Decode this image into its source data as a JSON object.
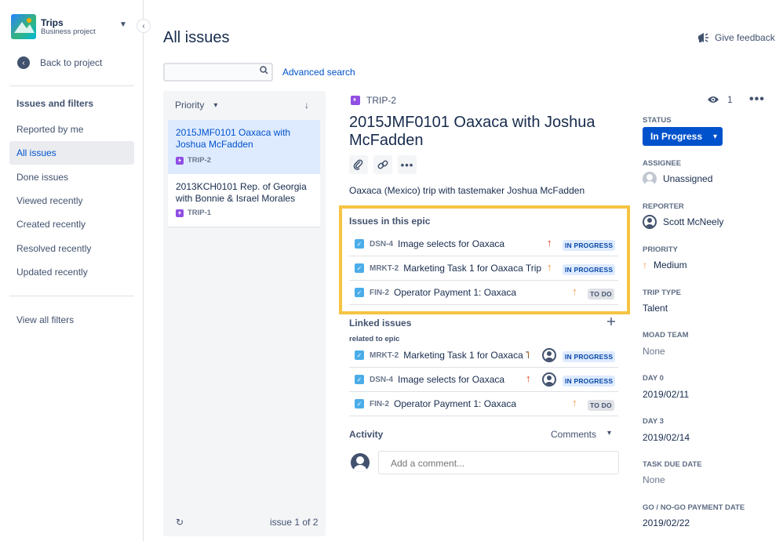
{
  "colors": {
    "accent": "#0052cc",
    "epic": "#904ee2",
    "task": "#4bade8",
    "highlight": "#f6c342",
    "priority_high": "#de350b",
    "priority_medium": "#f79233"
  },
  "sidebar": {
    "project_name": "Trips",
    "project_type": "Business project",
    "back_label": "Back to project",
    "heading": "Issues and filters",
    "items": [
      {
        "label": "Reported by me",
        "active": false
      },
      {
        "label": "All issues",
        "active": true
      },
      {
        "label": "Done issues",
        "active": false
      },
      {
        "label": "Viewed recently",
        "active": false
      },
      {
        "label": "Created recently",
        "active": false
      },
      {
        "label": "Resolved recently",
        "active": false
      },
      {
        "label": "Updated recently",
        "active": false
      }
    ],
    "view_all": "View all filters"
  },
  "header": {
    "title": "All issues",
    "feedback": "Give feedback",
    "search_placeholder": "",
    "advanced_search": "Advanced search"
  },
  "list": {
    "sort_label": "Priority",
    "cards": [
      {
        "summary": "2015JMF0101 Oaxaca with Joshua McFadden",
        "key": "TRIP-2",
        "selected": true
      },
      {
        "summary": "2013KCH0101 Rep. of Georgia with Bonnie & Israel Morales",
        "key": "TRIP-1",
        "selected": false
      }
    ],
    "pager": "issue 1 of 2"
  },
  "issue": {
    "key": "TRIP-2",
    "title": "2015JMF0101 Oaxaca with Joshua McFadden",
    "description": "Oaxaca (Mexico) trip with tastemaker Joshua McFadden",
    "epic_section_title": "Issues in this epic",
    "epic_issues": [
      {
        "key": "DSN-4",
        "summary": "Image selects for Oaxaca",
        "priority": "high",
        "status": "IN PROGRESS"
      },
      {
        "key": "MRKT-2",
        "summary": "Marketing Task 1 for Oaxaca Trip",
        "priority": "medium",
        "status": "IN PROGRESS"
      },
      {
        "key": "FIN-2",
        "summary": "Operator Payment 1: Oaxaca",
        "priority": "medium",
        "status": "TO DO"
      }
    ],
    "linked_title": "Linked issues",
    "linked_relation": "related to epic",
    "linked_issues": [
      {
        "key": "MRKT-2",
        "summary": "Marketing Task 1 for Oaxaca Trip",
        "priority": "medium",
        "status": "IN PROGRESS",
        "assignee": true
      },
      {
        "key": "DSN-4",
        "summary": "Image selects for Oaxaca",
        "priority": "high",
        "status": "IN PROGRESS",
        "assignee": true
      },
      {
        "key": "FIN-2",
        "summary": "Operator Payment 1: Oaxaca",
        "priority": "medium",
        "status": "TO DO",
        "assignee": false
      }
    ],
    "activity_title": "Activity",
    "comments_label": "Comments",
    "comment_placeholder": "Add a comment..."
  },
  "details": {
    "watch_count": "1",
    "status_label": "STATUS",
    "status_value": "In Progress",
    "assignee_label": "ASSIGNEE",
    "assignee_value": "Unassigned",
    "reporter_label": "REPORTER",
    "reporter_value": "Scott McNeely",
    "priority_label": "PRIORITY",
    "priority_value": "Medium",
    "trip_type_label": "TRIP TYPE",
    "trip_type_value": "Talent",
    "moad_team_label": "MOAD TEAM",
    "moad_team_value": "None",
    "day0_label": "DAY 0",
    "day0_value": "2019/02/11",
    "day3_label": "DAY 3",
    "day3_value": "2019/02/14",
    "task_due_label": "TASK DUE DATE",
    "task_due_value": "None",
    "gonogo_label": "GO / NO-GO PAYMENT DATE",
    "gonogo_value": "2019/02/22"
  }
}
